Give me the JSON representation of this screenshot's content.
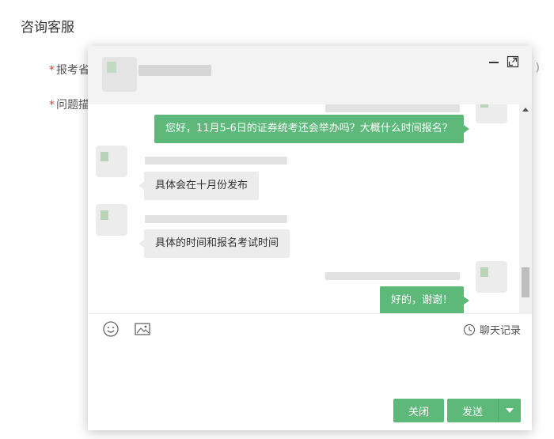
{
  "page": {
    "title": "咨询客服",
    "form": {
      "province_label": "报考省",
      "desc_label": "问题描",
      "right_hint": ")"
    }
  },
  "chat": {
    "header": {
      "agent_name": ""
    },
    "messages": [
      {
        "from": "user",
        "text": "您好，11月5-6日的证券统考还会举办吗？大概什么时间报名？"
      },
      {
        "from": "agent",
        "text": "具体会在十月份发布"
      },
      {
        "from": "agent",
        "text": "具体的时间和报名考试时间"
      },
      {
        "from": "user",
        "text": "好的，谢谢！"
      }
    ],
    "toolbar": {
      "emoji_icon": "smile-icon",
      "image_icon": "image-icon",
      "history_label": "聊天记录",
      "history_icon": "clock-icon"
    },
    "input": {
      "value": ""
    },
    "buttons": {
      "close_label": "关闭",
      "send_label": "发送"
    },
    "colors": {
      "accent": "#5cb979",
      "agent_bubble": "#ececec",
      "header_bg": "#f3f3f3"
    }
  }
}
